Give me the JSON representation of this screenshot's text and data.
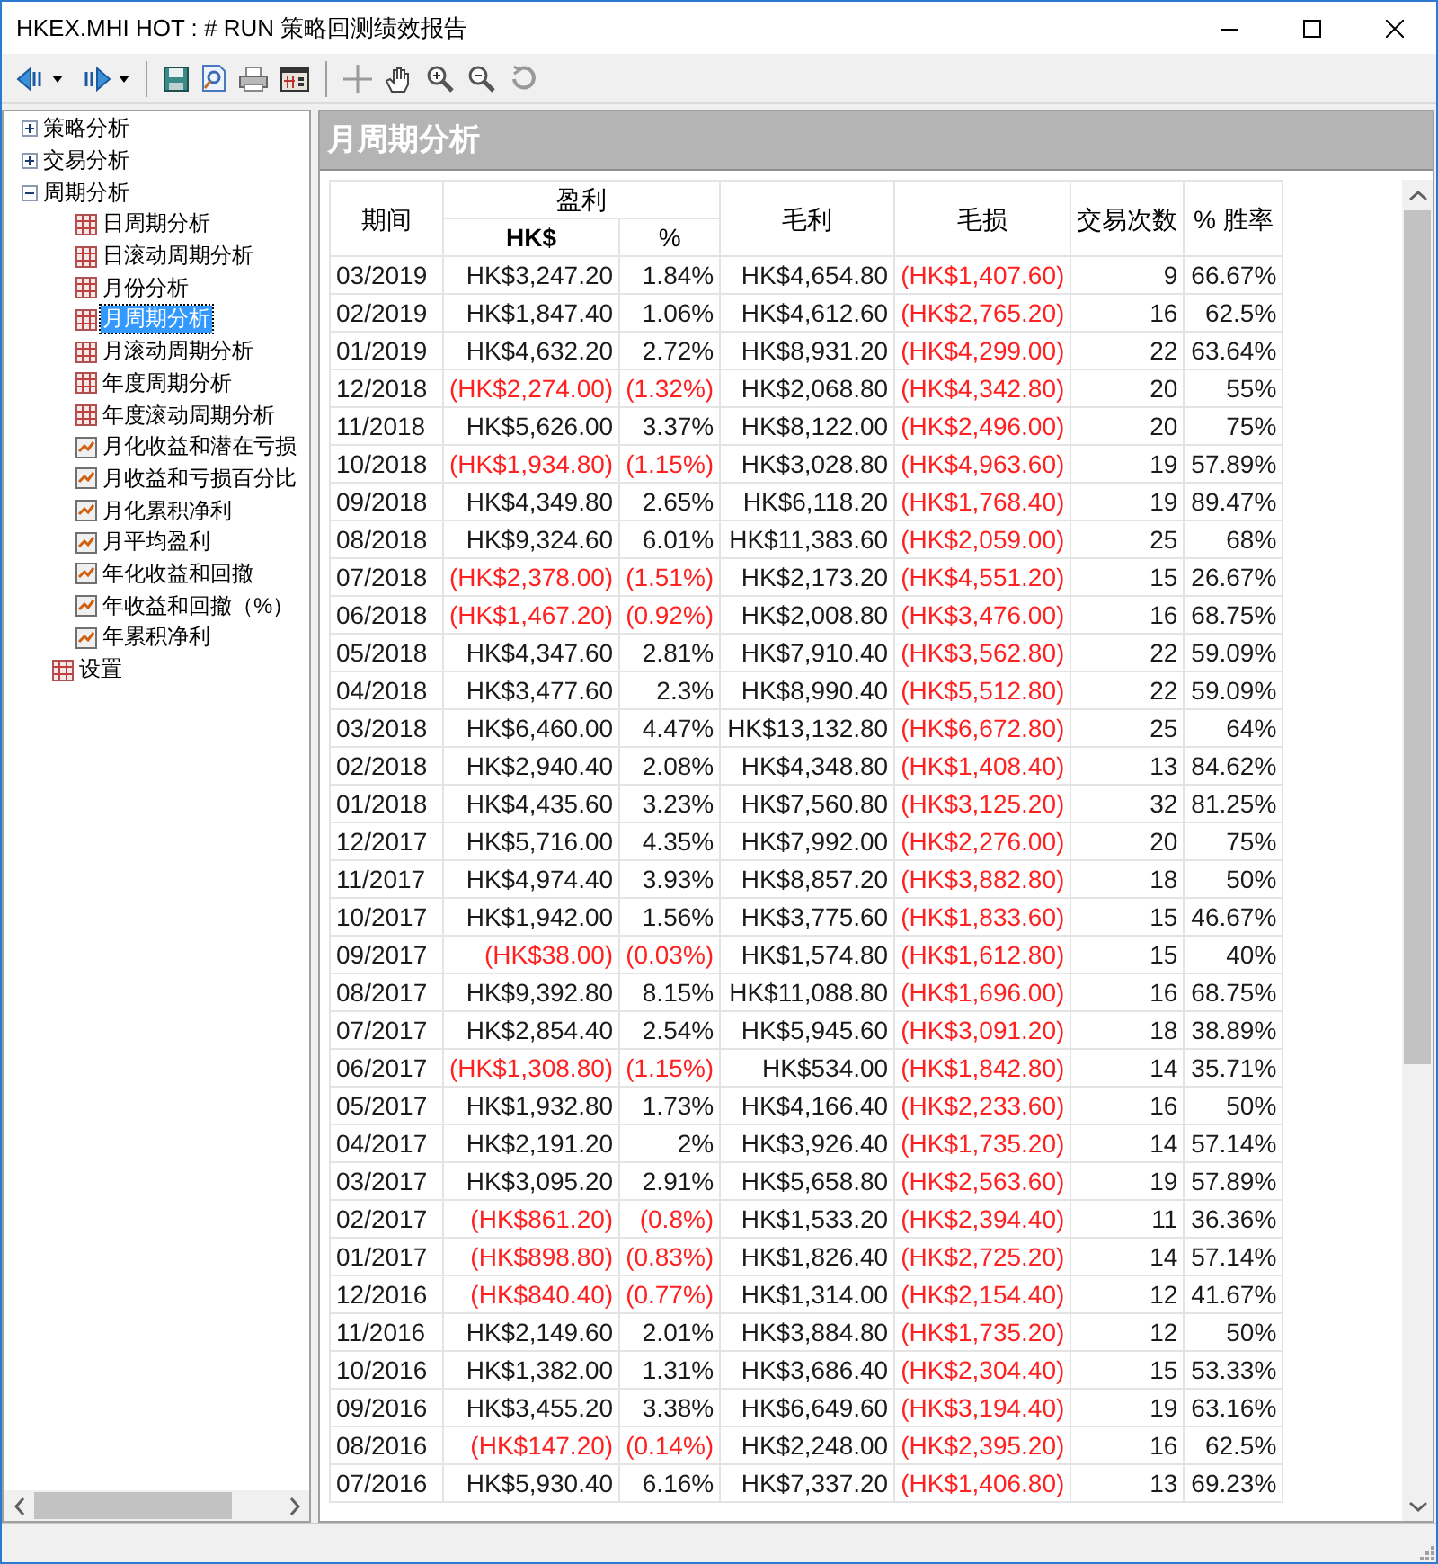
{
  "window": {
    "title": "HKEX.MHI HOT : # RUN 策略回测绩效报告"
  },
  "tree": [
    {
      "label": "策略分析",
      "kind": "group",
      "expanded": false,
      "selected": false
    },
    {
      "label": "交易分析",
      "kind": "group",
      "expanded": false,
      "selected": false
    },
    {
      "label": "周期分析",
      "kind": "group",
      "expanded": true,
      "selected": false,
      "children": [
        {
          "label": "日周期分析",
          "kind": "table",
          "selected": false
        },
        {
          "label": "日滚动周期分析",
          "kind": "table",
          "selected": false
        },
        {
          "label": "月份分析",
          "kind": "table",
          "selected": false
        },
        {
          "label": "月周期分析",
          "kind": "table",
          "selected": true
        },
        {
          "label": "月滚动周期分析",
          "kind": "table",
          "selected": false
        },
        {
          "label": "年度周期分析",
          "kind": "table",
          "selected": false
        },
        {
          "label": "年度滚动周期分析",
          "kind": "table",
          "selected": false
        },
        {
          "label": "月化收益和潜在亏损",
          "kind": "chart",
          "selected": false
        },
        {
          "label": "月收益和亏损百分比",
          "kind": "chart",
          "selected": false
        },
        {
          "label": "月化累积净利",
          "kind": "chart",
          "selected": false
        },
        {
          "label": "月平均盈利",
          "kind": "chart",
          "selected": false
        },
        {
          "label": "年化收益和回撤",
          "kind": "chart",
          "selected": false
        },
        {
          "label": "年收益和回撤（%）",
          "kind": "chart",
          "selected": false
        },
        {
          "label": "年累积净利",
          "kind": "chart",
          "selected": false
        }
      ]
    },
    {
      "label": "设置",
      "kind": "table",
      "selected": false
    }
  ],
  "panel": {
    "title": "月周期分析"
  },
  "table": {
    "headers": {
      "period": "期间",
      "profit": "盈利",
      "profit_amount": "HK$",
      "profit_pct": "%",
      "gross_profit": "毛利",
      "gross_loss": "毛损",
      "trades": "交易次数",
      "win_rate": "% 胜率"
    },
    "rows": [
      {
        "cells": [
          "03/2019",
          "HK$3,247.20",
          "1.84%",
          "HK$4,654.80",
          "(HK$1,407.60)",
          "9",
          "66.67%"
        ],
        "loss": false
      },
      {
        "cells": [
          "02/2019",
          "HK$1,847.40",
          "1.06%",
          "HK$4,612.60",
          "(HK$2,765.20)",
          "16",
          "62.5%"
        ],
        "loss": false
      },
      {
        "cells": [
          "01/2019",
          "HK$4,632.20",
          "2.72%",
          "HK$8,931.20",
          "(HK$4,299.00)",
          "22",
          "63.64%"
        ],
        "loss": false
      },
      {
        "cells": [
          "12/2018",
          "(HK$2,274.00)",
          "(1.32%)",
          "HK$2,068.80",
          "(HK$4,342.80)",
          "20",
          "55%"
        ],
        "loss": true
      },
      {
        "cells": [
          "11/2018",
          "HK$5,626.00",
          "3.37%",
          "HK$8,122.00",
          "(HK$2,496.00)",
          "20",
          "75%"
        ],
        "loss": false
      },
      {
        "cells": [
          "10/2018",
          "(HK$1,934.80)",
          "(1.15%)",
          "HK$3,028.80",
          "(HK$4,963.60)",
          "19",
          "57.89%"
        ],
        "loss": true
      },
      {
        "cells": [
          "09/2018",
          "HK$4,349.80",
          "2.65%",
          "HK$6,118.20",
          "(HK$1,768.40)",
          "19",
          "89.47%"
        ],
        "loss": false
      },
      {
        "cells": [
          "08/2018",
          "HK$9,324.60",
          "6.01%",
          "HK$11,383.60",
          "(HK$2,059.00)",
          "25",
          "68%"
        ],
        "loss": false
      },
      {
        "cells": [
          "07/2018",
          "(HK$2,378.00)",
          "(1.51%)",
          "HK$2,173.20",
          "(HK$4,551.20)",
          "15",
          "26.67%"
        ],
        "loss": true
      },
      {
        "cells": [
          "06/2018",
          "(HK$1,467.20)",
          "(0.92%)",
          "HK$2,008.80",
          "(HK$3,476.00)",
          "16",
          "68.75%"
        ],
        "loss": true
      },
      {
        "cells": [
          "05/2018",
          "HK$4,347.60",
          "2.81%",
          "HK$7,910.40",
          "(HK$3,562.80)",
          "22",
          "59.09%"
        ],
        "loss": false
      },
      {
        "cells": [
          "04/2018",
          "HK$3,477.60",
          "2.3%",
          "HK$8,990.40",
          "(HK$5,512.80)",
          "22",
          "59.09%"
        ],
        "loss": false
      },
      {
        "cells": [
          "03/2018",
          "HK$6,460.00",
          "4.47%",
          "HK$13,132.80",
          "(HK$6,672.80)",
          "25",
          "64%"
        ],
        "loss": false
      },
      {
        "cells": [
          "02/2018",
          "HK$2,940.40",
          "2.08%",
          "HK$4,348.80",
          "(HK$1,408.40)",
          "13",
          "84.62%"
        ],
        "loss": false
      },
      {
        "cells": [
          "01/2018",
          "HK$4,435.60",
          "3.23%",
          "HK$7,560.80",
          "(HK$3,125.20)",
          "32",
          "81.25%"
        ],
        "loss": false
      },
      {
        "cells": [
          "12/2017",
          "HK$5,716.00",
          "4.35%",
          "HK$7,992.00",
          "(HK$2,276.00)",
          "20",
          "75%"
        ],
        "loss": false
      },
      {
        "cells": [
          "11/2017",
          "HK$4,974.40",
          "3.93%",
          "HK$8,857.20",
          "(HK$3,882.80)",
          "18",
          "50%"
        ],
        "loss": false
      },
      {
        "cells": [
          "10/2017",
          "HK$1,942.00",
          "1.56%",
          "HK$3,775.60",
          "(HK$1,833.60)",
          "15",
          "46.67%"
        ],
        "loss": false
      },
      {
        "cells": [
          "09/2017",
          "(HK$38.00)",
          "(0.03%)",
          "HK$1,574.80",
          "(HK$1,612.80)",
          "15",
          "40%"
        ],
        "loss": true
      },
      {
        "cells": [
          "08/2017",
          "HK$9,392.80",
          "8.15%",
          "HK$11,088.80",
          "(HK$1,696.00)",
          "16",
          "68.75%"
        ],
        "loss": false
      },
      {
        "cells": [
          "07/2017",
          "HK$2,854.40",
          "2.54%",
          "HK$5,945.60",
          "(HK$3,091.20)",
          "18",
          "38.89%"
        ],
        "loss": false
      },
      {
        "cells": [
          "06/2017",
          "(HK$1,308.80)",
          "(1.15%)",
          "HK$534.00",
          "(HK$1,842.80)",
          "14",
          "35.71%"
        ],
        "loss": true
      },
      {
        "cells": [
          "05/2017",
          "HK$1,932.80",
          "1.73%",
          "HK$4,166.40",
          "(HK$2,233.60)",
          "16",
          "50%"
        ],
        "loss": false
      },
      {
        "cells": [
          "04/2017",
          "HK$2,191.20",
          "2%",
          "HK$3,926.40",
          "(HK$1,735.20)",
          "14",
          "57.14%"
        ],
        "loss": false
      },
      {
        "cells": [
          "03/2017",
          "HK$3,095.20",
          "2.91%",
          "HK$5,658.80",
          "(HK$2,563.60)",
          "19",
          "57.89%"
        ],
        "loss": false
      },
      {
        "cells": [
          "02/2017",
          "(HK$861.20)",
          "(0.8%)",
          "HK$1,533.20",
          "(HK$2,394.40)",
          "11",
          "36.36%"
        ],
        "loss": true
      },
      {
        "cells": [
          "01/2017",
          "(HK$898.80)",
          "(0.83%)",
          "HK$1,826.40",
          "(HK$2,725.20)",
          "14",
          "57.14%"
        ],
        "loss": true
      },
      {
        "cells": [
          "12/2016",
          "(HK$840.40)",
          "(0.77%)",
          "HK$1,314.00",
          "(HK$2,154.40)",
          "12",
          "41.67%"
        ],
        "loss": true
      },
      {
        "cells": [
          "11/2016",
          "HK$2,149.60",
          "2.01%",
          "HK$3,884.80",
          "(HK$1,735.20)",
          "12",
          "50%"
        ],
        "loss": false
      },
      {
        "cells": [
          "10/2016",
          "HK$1,382.00",
          "1.31%",
          "HK$3,686.40",
          "(HK$2,304.40)",
          "15",
          "53.33%"
        ],
        "loss": false
      },
      {
        "cells": [
          "09/2016",
          "HK$3,455.20",
          "3.38%",
          "HK$6,649.60",
          "(HK$3,194.40)",
          "19",
          "63.16%"
        ],
        "loss": false
      },
      {
        "cells": [
          "08/2016",
          "(HK$147.20)",
          "(0.14%)",
          "HK$2,248.00",
          "(HK$2,395.20)",
          "16",
          "62.5%"
        ],
        "loss": true
      },
      {
        "cells": [
          "07/2016",
          "HK$5,930.40",
          "6.16%",
          "HK$7,337.20",
          "(HK$1,406.80)",
          "13",
          "69.23%"
        ],
        "loss": false
      }
    ]
  }
}
